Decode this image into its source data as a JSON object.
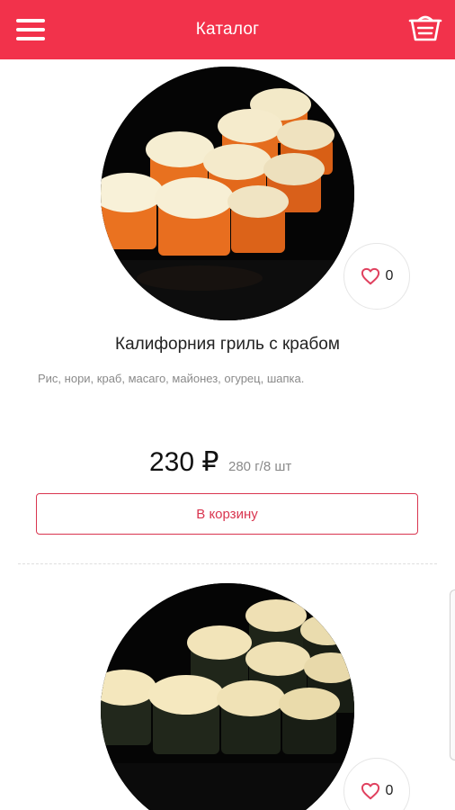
{
  "header": {
    "title": "Каталог",
    "menu_icon": "menu-icon",
    "cart_icon": "cart-icon"
  },
  "products": [
    {
      "name": "Калифорния гриль с крабом",
      "description": "Рис, нори, краб, масаго, майонез, огурец, шапка.",
      "price": "230 ₽",
      "weight": "280 г/8 шт",
      "likes": "0",
      "button_label": "В корзину"
    },
    {
      "likes": "0"
    }
  ],
  "colors": {
    "accent": "#f2324b",
    "button_border": "#d9354f"
  }
}
